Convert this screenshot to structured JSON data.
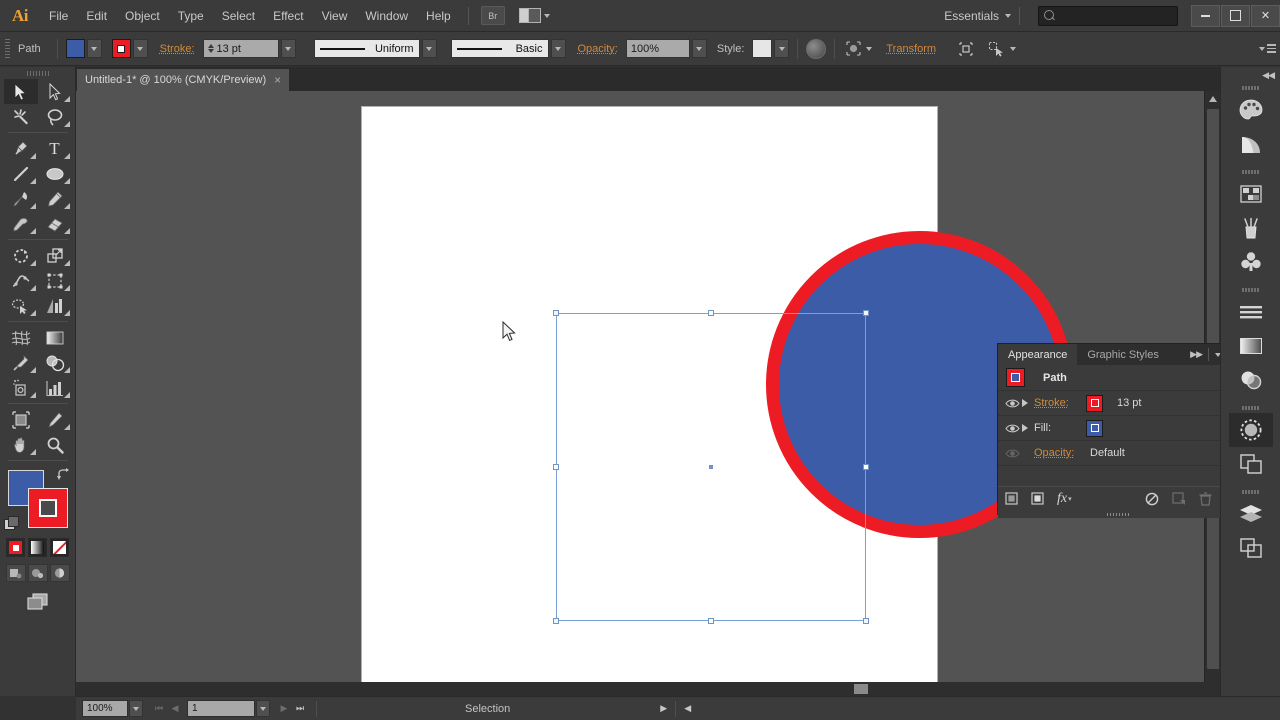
{
  "app": {
    "name": "Ai",
    "logo_color": "#f0a030"
  },
  "menubar": {
    "items": [
      "File",
      "Edit",
      "Object",
      "Type",
      "Select",
      "Effect",
      "View",
      "Window",
      "Help"
    ],
    "bridge_label": "Br",
    "workspace": "Essentials",
    "search_placeholder": "",
    "search_value": ""
  },
  "window_buttons": {
    "minimize": "minimize-icon",
    "maximize": "maximize-icon",
    "close": "✕"
  },
  "controlbar": {
    "selection_label": "Path",
    "fill_color": "#3d5ca8",
    "stroke_color": "#ed1c24",
    "stroke_label": "Stroke:",
    "stroke_weight": "13 pt",
    "profile_label": "Uniform",
    "brush_label": "Basic",
    "opacity_label": "Opacity:",
    "opacity_value": "100%",
    "style_label": "Style:",
    "transform_label": "Transform"
  },
  "document_tab": {
    "title": "Untitled-1* @ 100% (CMYK/Preview)",
    "close": "×"
  },
  "toolbar": {
    "tools": [
      "selection-tool",
      "direct-selection-tool",
      "magic-wand-tool",
      "lasso-tool",
      "pen-tool",
      "type-tool",
      "line-segment-tool",
      "ellipse-tool",
      "paintbrush-tool",
      "pencil-tool",
      "blob-brush-tool",
      "eraser-tool",
      "rotate-tool",
      "scale-tool",
      "width-tool",
      "free-transform-tool",
      "shape-builder-tool",
      "perspective-grid-tool",
      "mesh-tool",
      "gradient-tool",
      "eyedropper-tool",
      "blend-tool",
      "symbol-sprayer-tool",
      "column-graph-tool",
      "artboard-tool",
      "slice-tool",
      "hand-tool",
      "zoom-tool"
    ],
    "active_tool": "selection-tool",
    "fill_color": "#3d5ca8",
    "stroke_color": "#ed1c24",
    "color_modes": [
      "color-mode",
      "gradient-mode",
      "none-mode"
    ],
    "screen_modes": [
      "normal-screen-mode",
      "full-screen-menubar-mode",
      "full-screen-mode"
    ]
  },
  "canvas": {
    "shape": {
      "name": "ellipse",
      "fill_color": "#3d5ca8",
      "stroke_color": "#ed1c24",
      "stroke_width_px": 13
    },
    "artboard_color": "#ffffff",
    "background_color": "#535353",
    "selection_color": "#7aa0d4"
  },
  "appearance_panel": {
    "tabs": [
      {
        "label": "Appearance",
        "active": true
      },
      {
        "label": "Graphic Styles",
        "active": false
      }
    ],
    "object_title": "Path",
    "rows": [
      {
        "label": "Stroke:",
        "value": "13 pt",
        "swatch": "#ed1c24",
        "visible": true,
        "has_disclosure": true
      },
      {
        "label": "Fill:",
        "value": "",
        "swatch": "#3d5ca8",
        "visible": true,
        "has_disclosure": true
      },
      {
        "label": "Opacity:",
        "value": "Default",
        "swatch": null,
        "visible": false,
        "has_disclosure": false
      }
    ],
    "footer_buttons": [
      "add-new-stroke-icon",
      "add-new-fill-icon",
      "add-new-effect-icon",
      "clear-appearance-icon",
      "duplicate-item-icon",
      "delete-item-icon"
    ]
  },
  "right_dock": {
    "collapse_icon": "◀◀",
    "groups": [
      [
        "color-panel-icon",
        "color-guide-panel-icon"
      ],
      [
        "swatches-panel-icon",
        "brushes-panel-icon",
        "symbols-panel-icon"
      ],
      [
        "stroke-panel-icon",
        "gradient-panel-icon",
        "transparency-panel-icon"
      ],
      [
        "appearance-panel-icon",
        "graphic-styles-panel-icon"
      ],
      [
        "layers-panel-icon",
        "artboards-panel-icon"
      ]
    ],
    "selected": "appearance-panel-icon"
  },
  "statusbar": {
    "zoom": "100%",
    "page": "1",
    "status_text": "Selection"
  }
}
